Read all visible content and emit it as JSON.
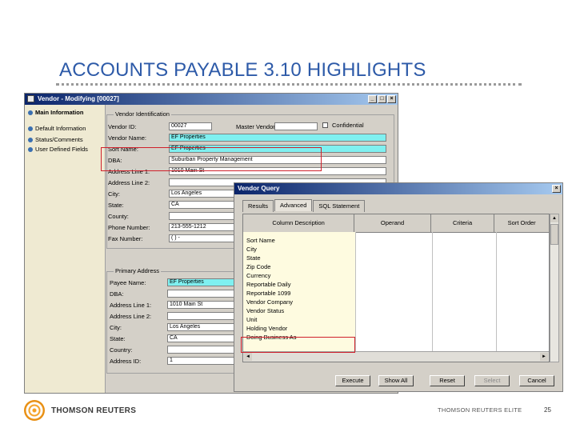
{
  "slide": {
    "title": "ACCOUNTS PAYABLE 3.10 HIGHLIGHTS"
  },
  "vendor_window": {
    "title": "Vendor - Modifying [00027]",
    "nav_items": [
      "Main Information",
      "Default Information",
      "Status/Comments",
      "User Defined Fields"
    ],
    "vendor_identification": {
      "group_title": "Vendor Identification",
      "vendor_id_label": "Vendor ID:",
      "vendor_id_value": "00027",
      "master_vendor_label": "Master Vendor",
      "master_vendor_value": "",
      "confidential_label": "Confidential",
      "vendor_name_label": "Vendor Name:",
      "vendor_name_value": "EF Properties",
      "sort_name_label": "Sort Name:",
      "sort_name_value": "EF Properties",
      "dba_label": "DBA:",
      "dba_value": "Suburban Property Management",
      "address1_label": "Address Line 1:",
      "address1_value": "1010 Main St",
      "address2_label": "Address Line 2:",
      "address2_value": "",
      "city_label": "City:",
      "city_value": "Los Angeles",
      "state_label": "State:",
      "state_value": "CA",
      "county_label": "County:",
      "county_value": "",
      "phone_label": "Phone Number:",
      "phone_value": "213-555-1212",
      "fax_label": "Fax Number:",
      "fax_value": "( ) -"
    },
    "primary_address": {
      "group_title": "Primary Address",
      "payee_name_label": "Payee Name:",
      "payee_name_value": "EF Properties",
      "dba_label": "DBA:",
      "dba_value": "",
      "address1_label": "Address Line 1:",
      "address1_value": "1010 Main St",
      "address2_label": "Address Line 2:",
      "address2_value": "",
      "city_label": "City:",
      "city_value": "Los Angeles",
      "state_label": "State:",
      "state_value": "CA",
      "country_label": "Country:",
      "country_value": "",
      "address_id_label": "Address ID:",
      "address_id_value": "1"
    }
  },
  "query_window": {
    "title": "Vendor Query",
    "tabs": [
      "Results",
      "Advanced",
      "SQL Statement"
    ],
    "columns": [
      "Column Description",
      "Operand",
      "Criteria",
      "Sort Order"
    ],
    "rows": [
      "Sort Name",
      "City",
      "State",
      "Zip Code",
      "Currency",
      "Reportable Daily",
      "Reportable 1099",
      "Vendor Company",
      "Vendor Status",
      "Unit",
      "Holding Vendor",
      "Doing Business As"
    ],
    "buttons": {
      "execute": "Execute",
      "show_all": "Show All",
      "reset": "Reset",
      "select": "Select",
      "cancel": "Cancel"
    }
  },
  "footer": {
    "logo_text": "THOMSON REUTERS",
    "company": "THOMSON REUTERS ELITE",
    "page": "25"
  },
  "colors": {
    "title": "#2d5aa8",
    "highlight": "#d0202b",
    "cyan_field": "#7ff0f0",
    "logo": "#f4a023"
  }
}
